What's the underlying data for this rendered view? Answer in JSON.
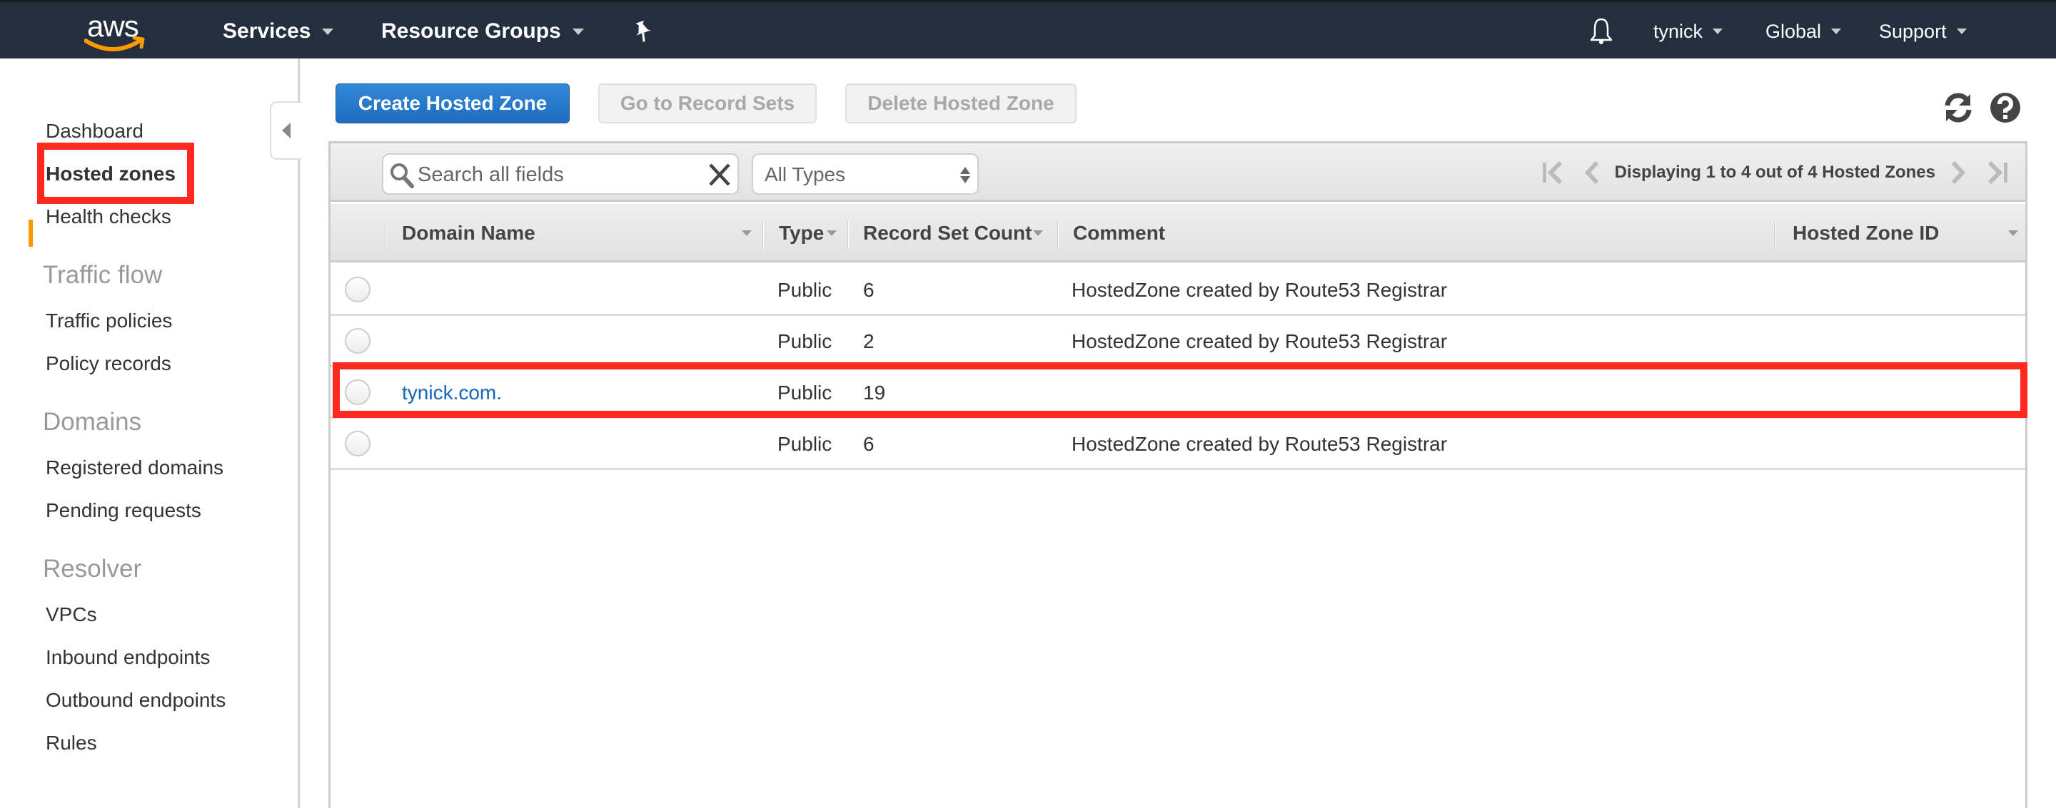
{
  "topnav": {
    "logo_text": "aws",
    "services": "Services",
    "resource_groups": "Resource Groups",
    "user": "tynick",
    "region": "Global",
    "support": "Support"
  },
  "sidebar": {
    "items": [
      {
        "label": "Dashboard"
      },
      {
        "label": "Hosted zones",
        "active": true
      },
      {
        "label": "Health checks"
      }
    ],
    "sections": [
      {
        "heading": "Traffic flow",
        "items": [
          {
            "label": "Traffic policies"
          },
          {
            "label": "Policy records"
          }
        ]
      },
      {
        "heading": "Domains",
        "items": [
          {
            "label": "Registered domains"
          },
          {
            "label": "Pending requests"
          }
        ]
      },
      {
        "heading": "Resolver",
        "items": [
          {
            "label": "VPCs"
          },
          {
            "label": "Inbound endpoints"
          },
          {
            "label": "Outbound endpoints"
          },
          {
            "label": "Rules"
          }
        ]
      }
    ]
  },
  "toolbar": {
    "create_label": "Create Hosted Zone",
    "goto_label": "Go to Record Sets",
    "delete_label": "Delete Hosted Zone"
  },
  "filter": {
    "search_placeholder": "Search all fields",
    "search_value": "",
    "type_selected": "All Types",
    "pager_text": "Displaying 1 to 4 out of 4 Hosted Zones"
  },
  "table": {
    "columns": [
      "Domain Name",
      "Type",
      "Record Set Count",
      "Comment",
      "Hosted Zone ID"
    ],
    "rows": [
      {
        "domain": "",
        "type": "Public",
        "count": "6",
        "comment": "HostedZone created by Route53 Registrar",
        "zone_id": ""
      },
      {
        "domain": "",
        "type": "Public",
        "count": "2",
        "comment": "HostedZone created by Route53 Registrar",
        "zone_id": ""
      },
      {
        "domain": "tynick.com.",
        "type": "Public",
        "count": "19",
        "comment": "",
        "zone_id": "",
        "highlighted": true
      },
      {
        "domain": "",
        "type": "Public",
        "count": "6",
        "comment": "HostedZone created by Route53 Registrar",
        "zone_id": ""
      }
    ]
  },
  "colors": {
    "nav_bg": "#232f3e",
    "accent_orange": "#ff9900",
    "primary_blue": "#1f6cbf",
    "link_blue": "#1166bb",
    "highlight_red": "#ff2a1f"
  }
}
